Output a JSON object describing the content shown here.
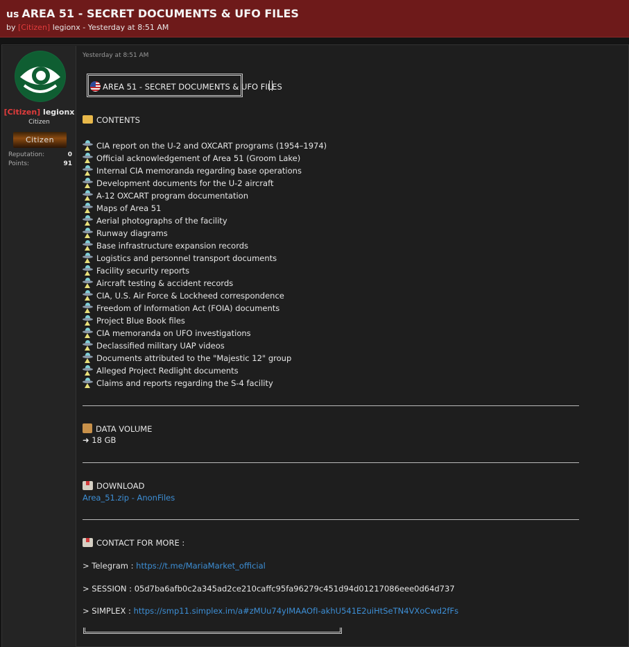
{
  "thread": {
    "flag_abbr": "us",
    "title": "AREA 51 - SECRET DOCUMENTS & UFO FILES",
    "by_prefix": "by",
    "author_rank": "[Citizen]",
    "author_name": "legionx",
    "separator": "-",
    "time": "Yesterday at 8:51 AM"
  },
  "user": {
    "rank": "[Citizen]",
    "name": "legionx",
    "title": "Citizen",
    "banner": "Citizen",
    "stats": [
      {
        "label": "Reputation:",
        "value": "0"
      },
      {
        "label": "Points:",
        "value": "91"
      }
    ]
  },
  "post": {
    "date": "Yesterday at 8:51 AM",
    "box_title": "AREA 51 - SECRET DOCUMENTS & UFO FILES",
    "contents_heading": "CONTENTS",
    "items": [
      "CIA report on the U-2 and OXCART programs (1954–1974)",
      "Official acknowledgement of Area 51 (Groom Lake)",
      "Internal CIA memoranda regarding base operations",
      "Development documents for the U-2 aircraft",
      "A-12 OXCART program documentation",
      "Maps of Area 51",
      "Aerial photographs of the facility",
      "Runway diagrams",
      "Base infrastructure expansion records",
      "Logistics and personnel transport documents",
      "Facility security reports",
      "Aircraft testing & accident records",
      "CIA, U.S. Air Force & Lockheed correspondence",
      "Freedom of Information Act (FOIA) documents",
      "Project Blue Book files",
      "CIA memoranda on UFO investigations",
      "Declassified military UAP videos",
      "Documents attributed to the \"Majestic 12\" group",
      "Alleged Project Redlight documents",
      "Claims and reports regarding the S-4 facility"
    ],
    "volume_heading": "DATA VOLUME",
    "volume_value": "➜ 18 GB",
    "download_heading": "DOWNLOAD",
    "download_link": "Area_51.zip - AnonFiles",
    "contact_heading": "CONTACT FOR MORE :",
    "telegram_label": "> Telegram :",
    "telegram_link": "https://t.me/MariaMarket_official",
    "session_text": "> SESSION : 05d7ba6afb0c2a345ad2ce210caffc95fa96279c451d94d01217086eee0d64d737",
    "simplex_label": "> SIMPLEX :",
    "simplex_link": "https://smp11.simplex.im/a#zMUu74yIMAAOfI-akhU541E2uiHtSeTN4VXoCwd2fFs"
  },
  "colors": {
    "header_bg": "#6e1a1a",
    "rank": "#e23c3c",
    "link": "#3d8fd6",
    "avatar_bg": "#13663a"
  }
}
